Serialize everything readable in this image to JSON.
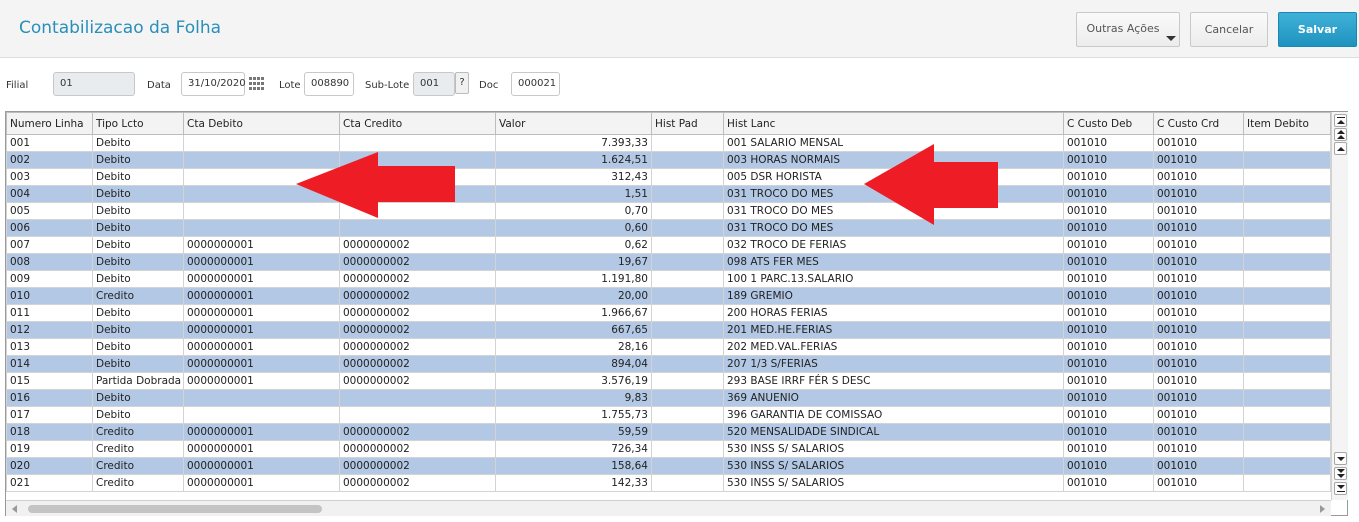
{
  "header": {
    "title": "Contabilizacao da Folha",
    "outras_acoes": "Outras Ações",
    "cancelar": "Cancelar",
    "salvar": "Salvar"
  },
  "fields": {
    "filial_label": "Filial",
    "filial_value": "01",
    "data_label": "Data",
    "data_value": "31/10/2020",
    "lote_label": "Lote",
    "lote_value": "008890",
    "sublote_label": "Sub-Lote",
    "sublote_value": "001",
    "help_label": "?",
    "doc_label": "Doc",
    "doc_value": "000021"
  },
  "grid": {
    "columns": [
      "Numero Linha",
      "Tipo Lcto",
      "Cta Debito",
      "Cta Credito",
      "Valor",
      "Hist Pad",
      "Hist Lanc",
      "C Custo Deb",
      "C Custo Crd",
      "Item Debito"
    ],
    "rows": [
      [
        "001",
        "Debito",
        "",
        "",
        "7.393,33",
        "",
        "001 SALARIO MENSAL",
        "001010",
        "001010",
        ""
      ],
      [
        "002",
        "Debito",
        "",
        "",
        "1.624,51",
        "",
        "003 HORAS NORMAIS",
        "001010",
        "001010",
        ""
      ],
      [
        "003",
        "Debito",
        "",
        "",
        "312,43",
        "",
        "005 DSR HORISTA",
        "001010",
        "001010",
        ""
      ],
      [
        "004",
        "Debito",
        "",
        "",
        "1,51",
        "",
        "031 TROCO DO MES",
        "001010",
        "001010",
        ""
      ],
      [
        "005",
        "Debito",
        "",
        "",
        "0,70",
        "",
        "031 TROCO DO MES",
        "001010",
        "001010",
        ""
      ],
      [
        "006",
        "Debito",
        "",
        "",
        "0,60",
        "",
        "031 TROCO DO MES",
        "001010",
        "001010",
        ""
      ],
      [
        "007",
        "Debito",
        "0000000001",
        "0000000002",
        "0,62",
        "",
        "032 TROCO DE FERIAS",
        "001010",
        "001010",
        ""
      ],
      [
        "008",
        "Debito",
        "0000000001",
        "0000000002",
        "19,67",
        "",
        "098 ATS FER MES",
        "001010",
        "001010",
        ""
      ],
      [
        "009",
        "Debito",
        "0000000001",
        "0000000002",
        "1.191,80",
        "",
        "100 1 PARC.13.SALARIO",
        "001010",
        "001010",
        ""
      ],
      [
        "010",
        "Credito",
        "0000000001",
        "0000000002",
        "20,00",
        "",
        "189 GREMIO",
        "001010",
        "001010",
        ""
      ],
      [
        "011",
        "Debito",
        "0000000001",
        "0000000002",
        "1.966,67",
        "",
        "200 HORAS FERIAS",
        "001010",
        "001010",
        ""
      ],
      [
        "012",
        "Debito",
        "0000000001",
        "0000000002",
        "667,65",
        "",
        "201 MED.HE.FERIAS",
        "001010",
        "001010",
        ""
      ],
      [
        "013",
        "Debito",
        "0000000001",
        "0000000002",
        "28,16",
        "",
        "202 MED.VAL.FERIAS",
        "001010",
        "001010",
        ""
      ],
      [
        "014",
        "Debito",
        "0000000001",
        "0000000002",
        "894,04",
        "",
        "207 1/3 S/FERIAS",
        "001010",
        "001010",
        ""
      ],
      [
        "015",
        "Partida Dobrada",
        "0000000001",
        "0000000002",
        "3.576,19",
        "",
        "293 BASE IRRF FÉR S DESC",
        "001010",
        "001010",
        ""
      ],
      [
        "016",
        "Debito",
        "",
        "",
        "9,83",
        "",
        "369 ANUENIO",
        "001010",
        "001010",
        ""
      ],
      [
        "017",
        "Debito",
        "",
        "",
        "1.755,73",
        "",
        "396 GARANTIA DE COMISSAO",
        "001010",
        "001010",
        ""
      ],
      [
        "018",
        "Credito",
        "0000000001",
        "0000000002",
        "59,59",
        "",
        "520 MENSALIDADE SINDICAL",
        "001010",
        "001010",
        ""
      ],
      [
        "019",
        "Credito",
        "0000000001",
        "0000000002",
        "726,34",
        "",
        "530 INSS S/ SALARIOS",
        "001010",
        "001010",
        ""
      ],
      [
        "020",
        "Credito",
        "0000000001",
        "0000000002",
        "158,64",
        "",
        "530 INSS S/ SALARIOS",
        "001010",
        "001010",
        ""
      ],
      [
        "021",
        "Credito",
        "0000000001",
        "0000000002",
        "142,33",
        "",
        "530 INSS S/ SALARIOS",
        "001010",
        "001010",
        ""
      ]
    ]
  },
  "colors": {
    "title": "#2a8fb8",
    "primary_button": "#2a9fcc",
    "row_alt": "#b3c8e4",
    "annotation_arrow": "#ee1c25"
  }
}
